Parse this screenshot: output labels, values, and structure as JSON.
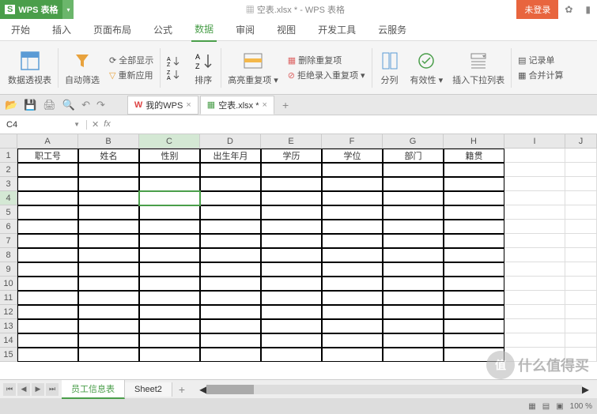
{
  "app": {
    "badge_s": "S",
    "name": "WPS 表格",
    "title": "空表.xlsx * - WPS 表格",
    "login": "未登录"
  },
  "menu": {
    "tabs": [
      "开始",
      "插入",
      "页面布局",
      "公式",
      "数据",
      "审阅",
      "视图",
      "开发工具",
      "云服务"
    ],
    "active": 4
  },
  "ribbon": {
    "pivot": "数据透视表",
    "autofilter": "自动筛选",
    "showall": "全部显示",
    "reapply": "重新应用",
    "sort": "排序",
    "highlight": "高亮重复项",
    "removedup": "删除重复项",
    "rejectdup": "拒绝录入重复项",
    "split": "分列",
    "validate": "有效性",
    "dropdown": "插入下拉列表",
    "form": "记录单",
    "consolidate": "合并计算"
  },
  "doctabs": {
    "wps": "我的WPS",
    "file": "空表.xlsx *"
  },
  "formula": {
    "cell": "C4",
    "fx": "fx"
  },
  "columns": [
    "A",
    "B",
    "C",
    "D",
    "E",
    "F",
    "G",
    "H",
    "I",
    "J"
  ],
  "headers": [
    "职工号",
    "姓名",
    "性别",
    "出生年月",
    "学历",
    "学位",
    "部门",
    "籍贯"
  ],
  "rows": 15,
  "selectedCell": {
    "row": 4,
    "col": 2
  },
  "sheets": {
    "active": "员工信息表",
    "other": "Sheet2"
  },
  "status": {
    "zoom": "100 %"
  },
  "watermark": "什么值得买"
}
